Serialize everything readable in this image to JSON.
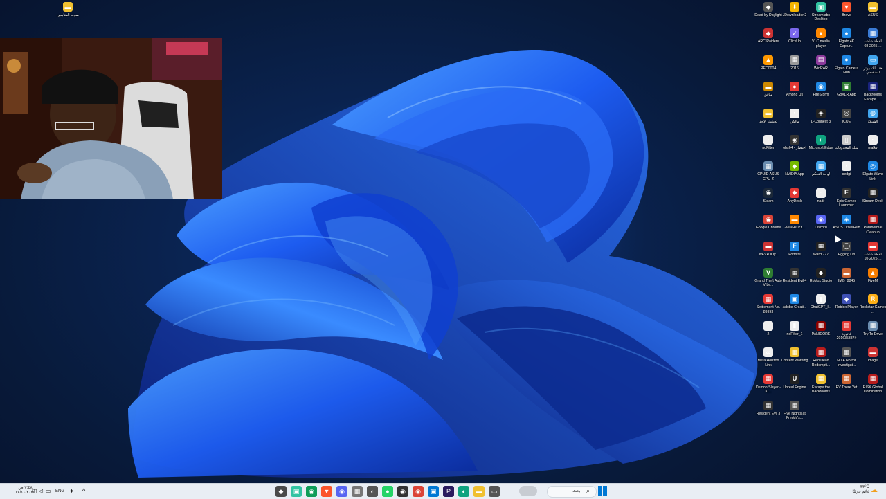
{
  "desktop_icons": [
    {
      "label": "صوت المتابعين",
      "color": "#f0c030",
      "glyph": "▬"
    },
    {
      "label": "Dead by Daylight",
      "color": "#555555",
      "glyph": "◆"
    },
    {
      "label": "JDownloader 2",
      "color": "#f4b400",
      "glyph": "⬇"
    },
    {
      "label": "Streamlabs Desktop",
      "color": "#31c3a2",
      "glyph": "▣"
    },
    {
      "label": "Brave",
      "color": "#fb542b",
      "glyph": "▼"
    },
    {
      "label": "ASUS",
      "color": "#f0c030",
      "glyph": "▬"
    },
    {
      "label": "ARC Raiders",
      "color": "#cc3333",
      "glyph": "◆"
    },
    {
      "label": "ClickUp",
      "color": "#7b68ee",
      "glyph": "✓"
    },
    {
      "label": "VLC media player",
      "color": "#ff8800",
      "glyph": "▲"
    },
    {
      "label": "Elgato 4K Captur...",
      "color": "#1e88e5",
      "glyph": "●"
    },
    {
      "label": "لقطة شاشة 2025-08-...",
      "color": "#3a7bd5",
      "glyph": "▦"
    },
    {
      "label": "REC0004",
      "color": "#ff9900",
      "glyph": "▲"
    },
    {
      "label": "2016",
      "color": "#999999",
      "glyph": "▦"
    },
    {
      "label": "WinRAR",
      "color": "#8b3a9b",
      "glyph": "▤"
    },
    {
      "label": "Elgato Camera Hub",
      "color": "#1e88e5",
      "glyph": "●"
    },
    {
      "label": "هذا الكمبيوتر الشخصي",
      "color": "#41a5ee",
      "glyph": "▭"
    },
    {
      "label": "منافق",
      "color": "#cc8800",
      "glyph": "▬"
    },
    {
      "label": "Among Us",
      "color": "#e53935",
      "glyph": "●"
    },
    {
      "label": "FireStorm",
      "color": "#1e88e5",
      "glyph": "◉"
    },
    {
      "label": "GoXLR App",
      "color": "#2e7d32",
      "glyph": "▣"
    },
    {
      "label": "Backrooms Escape T...",
      "color": "#1a237e",
      "glyph": "▦"
    },
    {
      "label": "تحديث الاحد",
      "color": "#f0c030",
      "glyph": "▬"
    },
    {
      "label": "مالكي",
      "color": "#eeeeee",
      "glyph": "·"
    },
    {
      "label": "L-Connect 3",
      "color": "#222222",
      "glyph": "◈"
    },
    {
      "label": "iCUE",
      "color": "#444444",
      "glyph": "◎"
    },
    {
      "label": "الشبكة",
      "color": "#41a5ee",
      "glyph": "◍"
    },
    {
      "label": "noFilter",
      "color": "#eeeeee",
      "glyph": "·"
    },
    {
      "label": "obs64 - اختصار",
      "color": "#333333",
      "glyph": "◉"
    },
    {
      "label": "Microsoft Edge",
      "color": "#0fa37f",
      "glyph": "◐"
    },
    {
      "label": "سلة المحذوفات",
      "color": "#cccccc",
      "glyph": "▯"
    },
    {
      "label": "malky",
      "color": "#eeeeee",
      "glyph": "·"
    },
    {
      "label": "CPUID ASUS CPU-Z",
      "color": "#6a8caf",
      "glyph": "▦"
    },
    {
      "label": "NVIDIA App",
      "color": "#76b900",
      "glyph": "◆"
    },
    {
      "label": "لوحة التحكم",
      "color": "#41a5ee",
      "glyph": "▦"
    },
    {
      "label": "sedgi",
      "color": "#eeeeee",
      "glyph": "·"
    },
    {
      "label": "Elgato Wave Link",
      "color": "#1e88e5",
      "glyph": "◎"
    },
    {
      "label": "Steam",
      "color": "#1b2838",
      "glyph": "◉"
    },
    {
      "label": "AnyDesk",
      "color": "#e53935",
      "glyph": "◆"
    },
    {
      "label": "nadr",
      "color": "#eeeeee",
      "glyph": "·"
    },
    {
      "label": "Epic Games Launcher",
      "color": "#333333",
      "glyph": "E"
    },
    {
      "label": "Stream Deck",
      "color": "#222222",
      "glyph": "▦"
    },
    {
      "label": "Google Chrome",
      "color": "#db4437",
      "glyph": "◉"
    },
    {
      "label": "-Ku9Hs0Zf...",
      "color": "#ff8800",
      "glyph": "▬"
    },
    {
      "label": "Discord",
      "color": "#5865f2",
      "glyph": "◉"
    },
    {
      "label": "ASUS DriverHub",
      "color": "#1e88e5",
      "glyph": "◈"
    },
    {
      "label": "Paranormal Cleanup",
      "color": "#b71c1c",
      "glyph": "▦"
    },
    {
      "label": "JvEVkDOy...",
      "color": "#cc3333",
      "glyph": "▬"
    },
    {
      "label": "Fortnite",
      "color": "#1e88e5",
      "glyph": "F"
    },
    {
      "label": "Ward 777",
      "color": "#222222",
      "glyph": "▦"
    },
    {
      "label": "Egging On",
      "color": "#444444",
      "glyph": "◯"
    },
    {
      "label": "لقطة شاشة 2025-10-...",
      "color": "#e53935",
      "glyph": "▬"
    },
    {
      "label": "Grand Theft Auto V Le...",
      "color": "#2e7d32",
      "glyph": "V"
    },
    {
      "label": "Resident Evil 4",
      "color": "#333333",
      "glyph": "▦"
    },
    {
      "label": "Roblox Studio",
      "color": "#222222",
      "glyph": "◆"
    },
    {
      "label": "IMG_8845",
      "color": "#cc6633",
      "glyph": "▬"
    },
    {
      "label": "FiveM",
      "color": "#f57c00",
      "glyph": "▲"
    },
    {
      "label": "Settlement No. 89993",
      "color": "#e53935",
      "glyph": "▦"
    },
    {
      "label": "Adobe Creati...",
      "color": "#1e88e5",
      "glyph": "▣"
    },
    {
      "label": "ChatGPT_I...",
      "color": "#eeeeee",
      "glyph": "▮"
    },
    {
      "label": "Roblox Player",
      "color": "#3f51b5",
      "glyph": "◆"
    },
    {
      "label": "Rockstar Games ...",
      "color": "#fcaf17",
      "glyph": "R"
    },
    {
      "label": "2",
      "color": "#eeeeee",
      "glyph": "·"
    },
    {
      "label": "noFilter_1",
      "color": "#eeeeee",
      "glyph": "▮"
    },
    {
      "label": "PANICORE",
      "color": "#8b0000",
      "glyph": "▦"
    },
    {
      "label": "فاتورة #201635387",
      "color": "#e53935",
      "glyph": "▤"
    },
    {
      "label": "Try To Drive",
      "color": "#6a8caf",
      "glyph": "▦"
    },
    {
      "label": "Meta Horizon Link",
      "color": "#eeeeee",
      "glyph": "∞"
    },
    {
      "label": "Content Warning",
      "color": "#f0c030",
      "glyph": "▦"
    },
    {
      "label": "Red Dead Redempti...",
      "color": "#b71c1c",
      "glyph": "▦"
    },
    {
      "label": "H.I.A Horror Investigat...",
      "color": "#555555",
      "glyph": "▦"
    },
    {
      "label": "image",
      "color": "#cc3333",
      "glyph": "▬"
    },
    {
      "label": "Demon Slayer -Ki...",
      "color": "#e53935",
      "glyph": "▦"
    },
    {
      "label": "Unreal Engine",
      "color": "#222222",
      "glyph": "U"
    },
    {
      "label": "Escape the Backrooms",
      "color": "#f0c030",
      "glyph": "▦"
    },
    {
      "label": "RV There Yet",
      "color": "#cc6633",
      "glyph": "▦"
    },
    {
      "label": "RISK Global Domination",
      "color": "#b71c1c",
      "glyph": "▦"
    },
    {
      "label": "Resident Evil 3",
      "color": "#333333",
      "glyph": "▦"
    },
    {
      "label": "Five Nights at Freddy's...",
      "color": "#555555",
      "glyph": "▦"
    }
  ],
  "taskbar": {
    "clock_time": "٧:٤٨ ص",
    "clock_date": "١٧/١٠/٢٠٢٥",
    "language": "ENG",
    "search_label": "بحث",
    "weather_temp": "٣٣°C",
    "weather_desc": "غائم جزئيًا",
    "apps": [
      {
        "name": "mail-app-icon",
        "color": "#4a4a4a",
        "glyph": "◆"
      },
      {
        "name": "streamlabs-icon",
        "color": "#31c3a2",
        "glyph": "▣"
      },
      {
        "name": "chrome-alt-icon",
        "color": "#0f9d58",
        "glyph": "◉"
      },
      {
        "name": "brave-icon",
        "color": "#fb542b",
        "glyph": "▼"
      },
      {
        "name": "discord-icon",
        "color": "#5865f2",
        "glyph": "◉"
      },
      {
        "name": "capture-icon",
        "color": "#777777",
        "glyph": "▦"
      },
      {
        "name": "davinci-icon",
        "color": "#555555",
        "glyph": "◐"
      },
      {
        "name": "whatsapp-icon",
        "color": "#25d366",
        "glyph": "●"
      },
      {
        "name": "obs-icon",
        "color": "#333333",
        "glyph": "◉"
      },
      {
        "name": "chrome-icon",
        "color": "#db4437",
        "glyph": "◉"
      },
      {
        "name": "store-icon",
        "color": "#0078d4",
        "glyph": "▣"
      },
      {
        "name": "premiere-icon",
        "color": "#2a1b5e",
        "glyph": "P"
      },
      {
        "name": "edge-icon",
        "color": "#0fa37f",
        "glyph": "◐"
      },
      {
        "name": "file-explorer-icon",
        "color": "#f0c030",
        "glyph": "▬"
      },
      {
        "name": "terminal-icon",
        "color": "#555555",
        "glyph": "▭"
      }
    ]
  }
}
